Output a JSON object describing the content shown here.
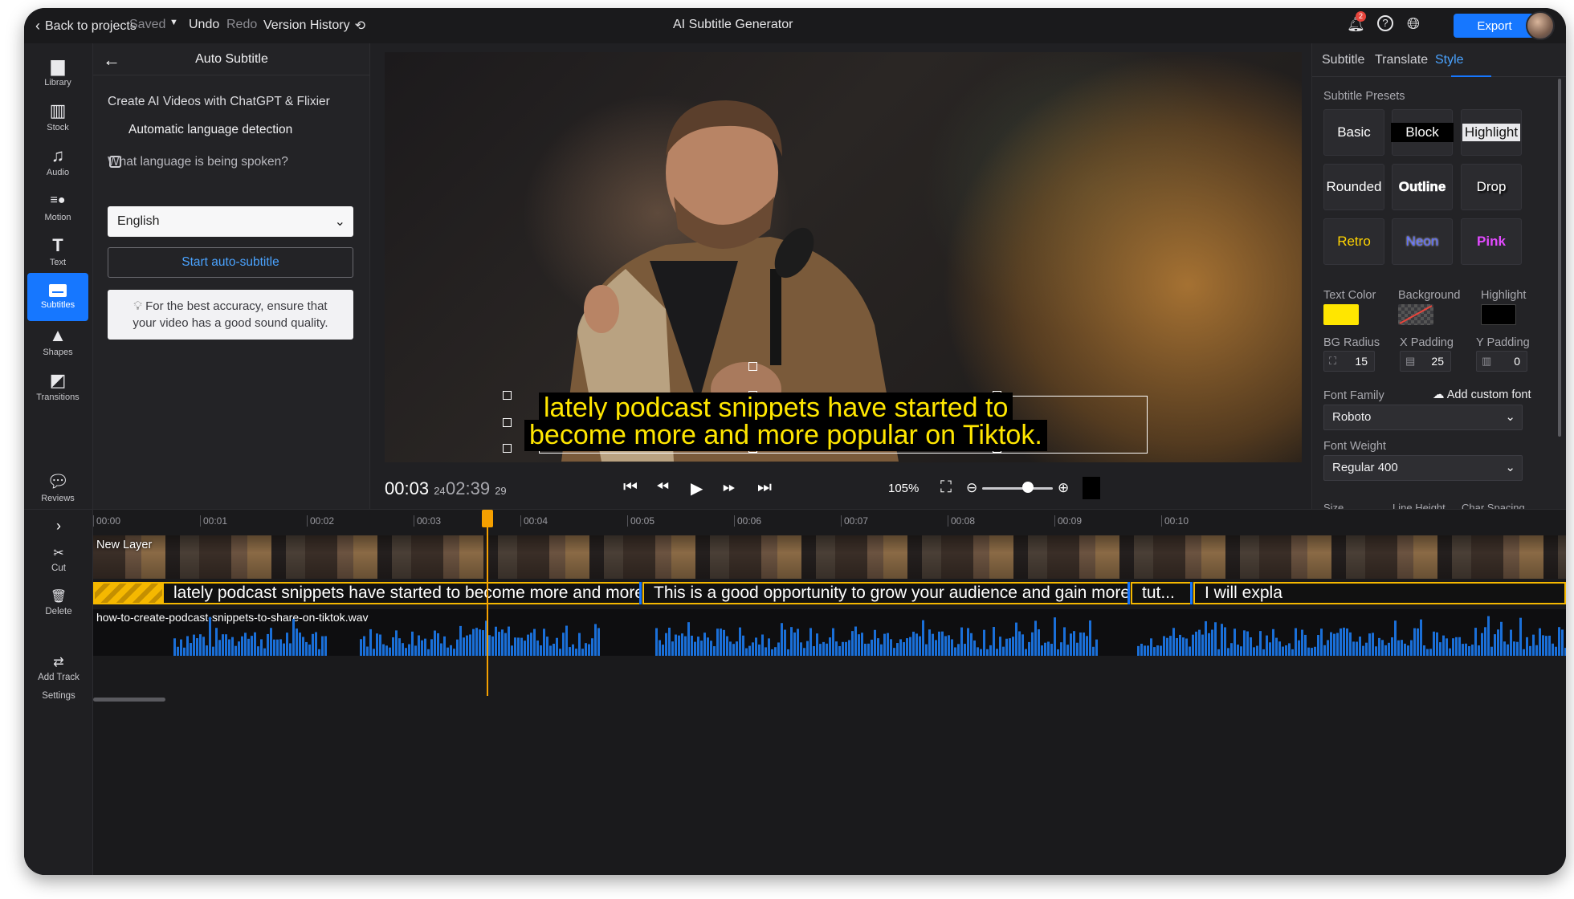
{
  "topbar": {
    "back": "Back to projects",
    "saved": "Saved",
    "undo": "Undo",
    "redo": "Redo",
    "version_history": "Version History",
    "title": "AI Subtitle Generator",
    "notification_count": "2",
    "export": "Export"
  },
  "sidebar": {
    "items": [
      {
        "label": "Library",
        "icon": "folder-icon"
      },
      {
        "label": "Stock",
        "icon": "stock-icon"
      },
      {
        "label": "Audio",
        "icon": "music-icon"
      },
      {
        "label": "Motion",
        "icon": "motion-icon"
      },
      {
        "label": "Text",
        "icon": "text-icon"
      },
      {
        "label": "Subtitles",
        "icon": "subtitles-icon",
        "active": true
      },
      {
        "label": "Shapes",
        "icon": "shapes-icon"
      },
      {
        "label": "Transitions",
        "icon": "transitions-icon"
      },
      {
        "label": "Reviews",
        "icon": "reviews-icon"
      }
    ]
  },
  "panel": {
    "title": "Auto Subtitle",
    "intro": "Create AI Videos with ChatGPT & Flixier",
    "auto_detect_label": "Automatic language detection",
    "language_question": "What language is being spoken?",
    "language_value": "English",
    "start_button": "Start auto-subtitle",
    "tip_line1": "For the best accuracy, ensure that",
    "tip_line2": "your video has a good sound quality."
  },
  "video": {
    "subtitle_line1": "lately podcast snippets have started to",
    "subtitle_line2": "become more and more popular on Tiktok."
  },
  "controls": {
    "current_time": "00:03",
    "current_frame": "24",
    "total_time": "02:39",
    "total_frame": "29",
    "zoom": "105%",
    "zoom_level": 0.65
  },
  "right": {
    "tabs": [
      "Subtitle",
      "Translate",
      "Style"
    ],
    "active_tab": "Style",
    "presets_label": "Subtitle Presets",
    "presets": [
      "Basic",
      "Block",
      "Highlight",
      "Rounded",
      "Outline",
      "Drop",
      "Retro",
      "Neon",
      "Pink"
    ],
    "text_color_label": "Text Color",
    "background_label": "Background",
    "highlight_label": "Highlight",
    "text_color": "#ffe600",
    "highlight_color": "#000000",
    "bg_radius_label": "BG Radius",
    "bg_radius": "15",
    "x_padding_label": "X Padding",
    "x_padding": "25",
    "y_padding_label": "Y Padding",
    "y_padding": "0",
    "font_family_label": "Font Family",
    "add_font": "Add custom font",
    "font_family": "Roboto",
    "font_weight_label": "Font Weight",
    "font_weight": "Regular 400",
    "size_label": "Size",
    "line_height_label": "Line Height",
    "char_spacing_label": "Char Spacing"
  },
  "timeline": {
    "side": {
      "cut": "Cut",
      "delete": "Delete",
      "add_track": "Add Track",
      "settings": "Settings"
    },
    "ticks": [
      "00:00",
      "00:01",
      "00:02",
      "00:03",
      "00:04",
      "00:05",
      "00:06",
      "00:07",
      "00:08",
      "00:09",
      "00:10"
    ],
    "video_layer": "New Layer",
    "subtitle_clips": [
      "lately podcast snippets have started to become more and more p...",
      "This is a good opportunity to grow your audience and gain more fol...",
      "tut...",
      "I will expla"
    ],
    "audio_file": "how-to-create-podcast-snippets-to-share-on-tiktok.wav"
  },
  "colors": {
    "accent": "#1677ff",
    "playhead": "#f5a000",
    "subtitle_text": "#ffe600"
  }
}
